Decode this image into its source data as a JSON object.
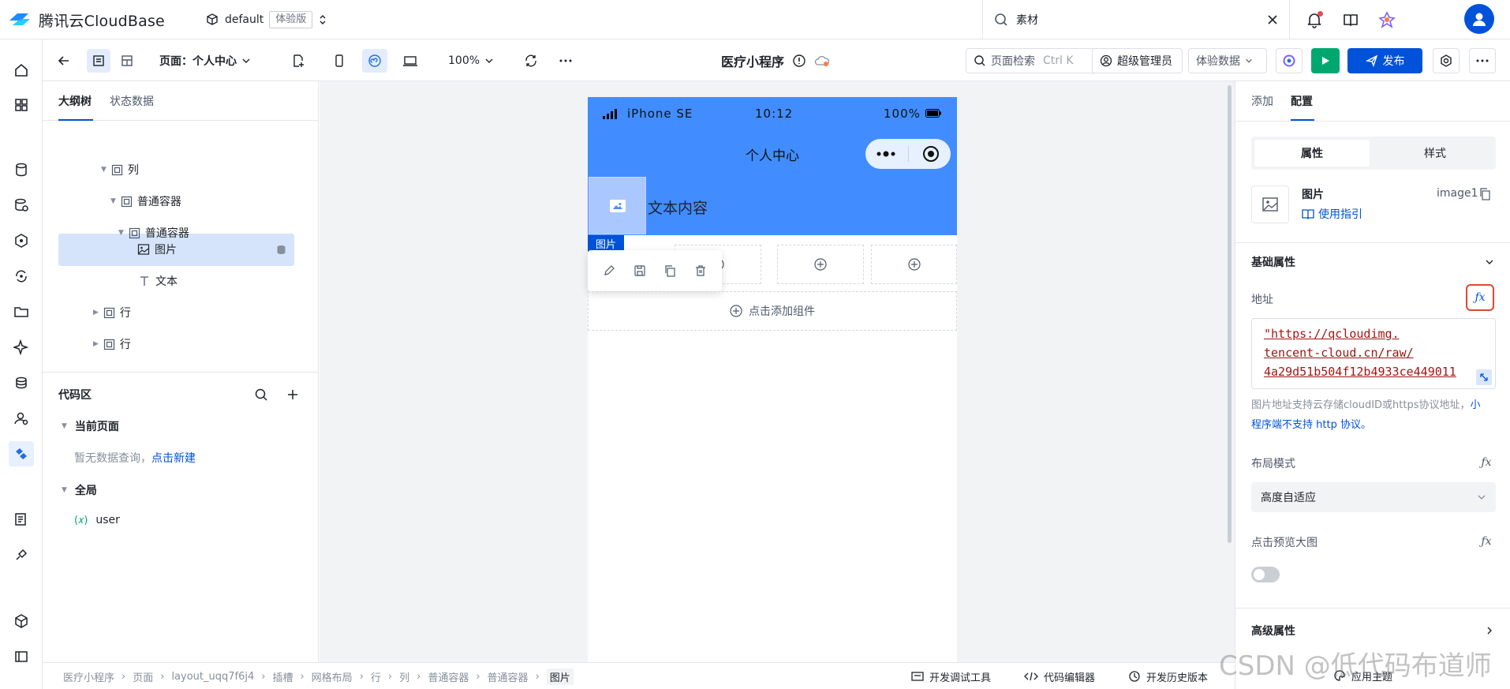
{
  "topbar": {
    "brand": "腾讯云CloudBase",
    "env_name": "default",
    "env_badge": "体验版",
    "search_value": "素材"
  },
  "toolbar": {
    "page_label": "页面：个人中心",
    "zoom": "100%",
    "app_title": "医疗小程序",
    "page_search": "页面检索",
    "page_search_shortcut": "Ctrl K",
    "admin": "超级管理员",
    "data_mode": "体验数据",
    "publish": "发布"
  },
  "outline": {
    "tabs": [
      "大纲树",
      "状态数据"
    ],
    "tree": [
      {
        "label": "列",
        "icon": "container-icon"
      },
      {
        "label": "普通容器",
        "icon": "container-icon"
      },
      {
        "label": "普通容器",
        "icon": "container-icon"
      },
      {
        "label": "图片",
        "icon": "image-icon"
      },
      {
        "label": "文本",
        "icon": "text-icon"
      },
      {
        "label": "行",
        "icon": "container-icon"
      },
      {
        "label": "行",
        "icon": "container-icon"
      }
    ],
    "code": {
      "title": "代码区",
      "current_page": "当前页面",
      "empty_text": "暂无数据查询，",
      "create_link": "点击新建",
      "global": "全局",
      "var_name": "user",
      "var_prefix": "(𝑥)"
    }
  },
  "phone": {
    "carrier": "iPhone SE",
    "time": "10:12",
    "battery": "100%",
    "nav_title": "个人中心",
    "text_content": "文本内容",
    "selected_tag": "图片",
    "add_component": "点击添加组件"
  },
  "right": {
    "tabs": [
      "添加",
      "配置"
    ],
    "seg": [
      "属性",
      "样式"
    ],
    "component_name": "图片",
    "component_id": "image1",
    "guide": "使用指引",
    "basic_props": "基础属性",
    "address_label": "地址",
    "url_lines": [
      "\"https://qcloudimg.",
      "tencent-cloud.cn/raw/",
      "4a29d51b504f12b4933ce449011"
    ],
    "hint_text": "图片地址支持云存储cloudID或https协议地址，",
    "hint_link": "小程序端不支持 http 协议。",
    "layout_label": "布局模式",
    "layout_value": "高度自适应",
    "preview_label": "点击预览大图",
    "preview_enabled": false,
    "advanced": "高级属性"
  },
  "footer": {
    "breadcrumb": [
      "医疗小程序",
      "页面",
      "layout_uqq7f6j4",
      "插槽",
      "网格布局",
      "行",
      "列",
      "普通容器",
      "普通容器",
      "图片"
    ],
    "tools": [
      "开发调试工具",
      "代码编辑器",
      "开发历史版本",
      "应用主题"
    ]
  },
  "watermark": "CSDN @低代码布道师",
  "colors": {
    "primary": "#0052d9",
    "phone_header": "#418dff",
    "run": "#00a870",
    "url": "#a31515"
  }
}
